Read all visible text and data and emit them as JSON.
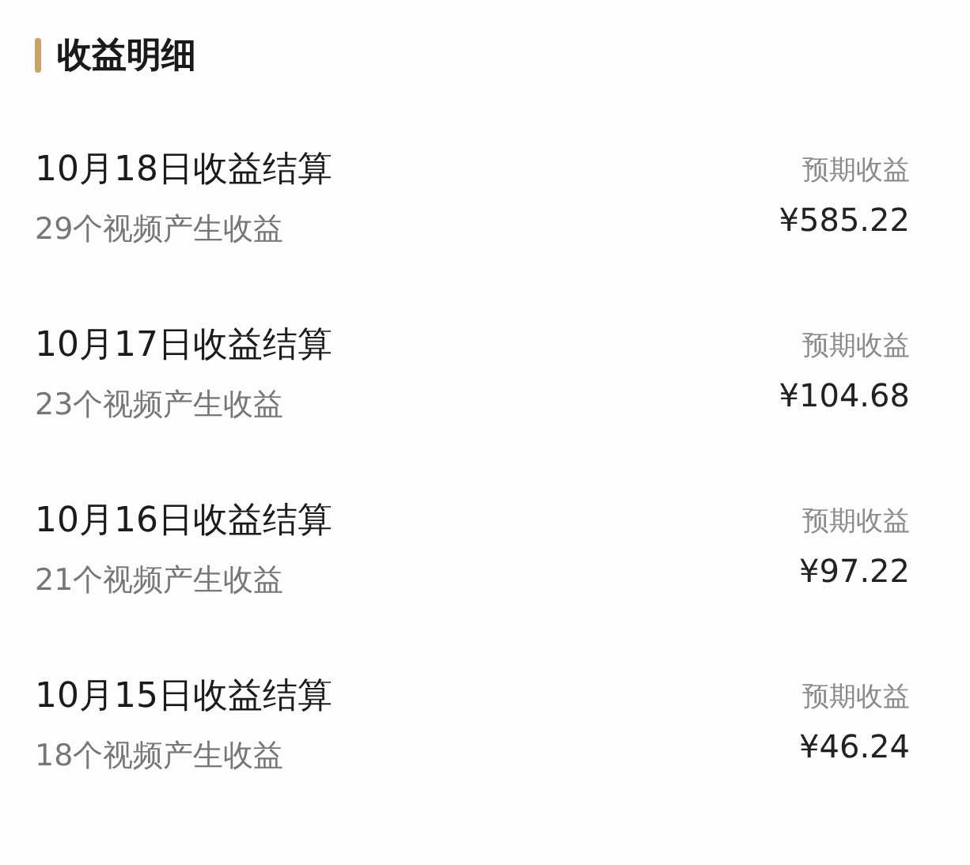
{
  "header": {
    "title": "收益明细"
  },
  "settlements": [
    {
      "date_title": "10月18日收益结算",
      "subtitle": "29个视频产生收益",
      "label": "预期收益",
      "amount": "¥585.22"
    },
    {
      "date_title": "10月17日收益结算",
      "subtitle": "23个视频产生收益",
      "label": "预期收益",
      "amount": "¥104.68"
    },
    {
      "date_title": "10月16日收益结算",
      "subtitle": "21个视频产生收益",
      "label": "预期收益",
      "amount": "¥97.22"
    },
    {
      "date_title": "10月15日收益结算",
      "subtitle": "18个视频产生收益",
      "label": "预期收益",
      "amount": "¥46.24"
    }
  ]
}
